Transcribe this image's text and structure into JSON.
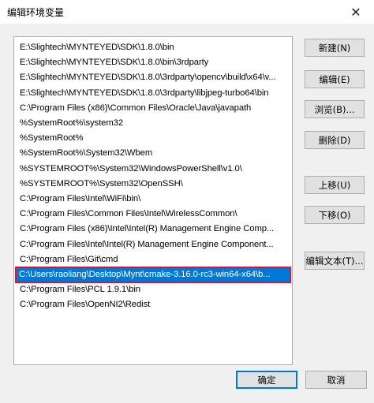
{
  "window": {
    "title": "编辑环境变量",
    "close_glyph": "✕"
  },
  "paths": [
    "E:\\Slightech\\MYNTEYED\\SDK\\1.8.0\\bin",
    "E:\\Slightech\\MYNTEYED\\SDK\\1.8.0\\bin\\3rdparty",
    "E:\\Slightech\\MYNTEYED\\SDK\\1.8.0\\3rdparty\\opencv\\build\\x64\\v...",
    "E:\\Slightech\\MYNTEYED\\SDK\\1.8.0\\3rdparty\\libjpeg-turbo64\\bin",
    "C:\\Program Files (x86)\\Common Files\\Oracle\\Java\\javapath",
    "%SystemRoot%\\system32",
    "%SystemRoot%",
    "%SystemRoot%\\System32\\Wbem",
    "%SYSTEMROOT%\\System32\\WindowsPowerShell\\v1.0\\",
    "%SYSTEMROOT%\\System32\\OpenSSH\\",
    "C:\\Program Files\\Intel\\WiFi\\bin\\",
    "C:\\Program Files\\Common Files\\Intel\\WirelessCommon\\",
    "C:\\Program Files (x86)\\Intel\\Intel(R) Management Engine Comp...",
    "C:\\Program Files\\Intel\\Intel(R) Management Engine Component...",
    "C:\\Program Files\\Git\\cmd",
    "C:\\Users\\raoliang\\Desktop\\Mynt\\cmake-3.16.0-rc3-win64-x64\\b...",
    "C:\\Program Files\\PCL 1.9.1\\bin",
    "C:\\Program Files\\OpenNI2\\Redist"
  ],
  "selected_index": 15,
  "buttons": {
    "new": "新建(N)",
    "edit": "编辑(E)",
    "browse": "浏览(B)...",
    "delete": "删除(D)",
    "move_up": "上移(U)",
    "move_down": "下移(O)",
    "edit_text": "编辑文本(T)...",
    "ok": "确定",
    "cancel": "取消"
  }
}
